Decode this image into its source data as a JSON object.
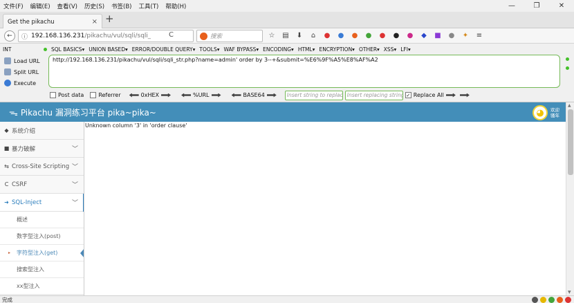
{
  "menubar": {
    "items": [
      "文件(F)",
      "编辑(E)",
      "查看(V)",
      "历史(S)",
      "书签(B)",
      "工具(T)",
      "帮助(H)"
    ]
  },
  "window_controls": [
    "—",
    "❐",
    "✕"
  ],
  "tab": {
    "title": "Get the pikachu",
    "close": "×",
    "new": "+"
  },
  "navbar": {
    "back": "←",
    "info": "ⓘ",
    "url_host": "192.168.136.231",
    "url_path": "/pikachu/vul/sqli/sqli_",
    "reload": "C",
    "search_placeholder": "搜索"
  },
  "hackbar": {
    "select_value": "INT",
    "menu": [
      "SQL BASICS▾",
      "UNION BASED▾",
      "ERROR/DOUBLE QUERY▾",
      "TOOLS▾",
      "WAF BYPASS▾",
      "ENCODING▾",
      "HTML▾",
      "ENCRYPTION▾",
      "OTHER▾",
      "XSS▾",
      "LFI▾"
    ],
    "load_url": "Load URL",
    "split_url": "Split URL",
    "execute": "Execute",
    "url_value": "http://192.168.136.231/pikachu/vul/sqli/sqli_str.php?name=admin' order by 3--+&submit=%E6%9F%A5%E8%AF%A2",
    "post_data": "Post data",
    "referrer": "Referrer",
    "hex": "0xHEX",
    "url_enc": "%URL",
    "base64": "BASE64",
    "replace_placeholder": "Insert string to replace",
    "replacing_placeholder": "Insert replacing string",
    "replace_all": "Replace All",
    "replace_all_checked": "✓"
  },
  "header": {
    "logo": "ᯓ",
    "title": "Pikachu 漏洞练习平台 pika~pika~",
    "welcome": "欢迎 骚年"
  },
  "sidebar": {
    "items": [
      {
        "icon": "◆",
        "label": "系统介绍",
        "chevron": ""
      },
      {
        "icon": "■",
        "label": "暴力破解",
        "chevron": "﹀"
      },
      {
        "icon": "⇆",
        "label": "Cross-Site Scripting",
        "chevron": "﹀"
      },
      {
        "icon": "C",
        "label": "CSRF",
        "chevron": "﹀"
      },
      {
        "icon": "➜",
        "label": "SQL-Inject",
        "chevron": "﹀"
      }
    ],
    "sub": [
      "概述",
      "数字型注入(post)",
      "字符型注入(get)",
      "搜索型注入",
      "xx型注入"
    ],
    "current_mark": "▸"
  },
  "main": {
    "error": "Unknown column '3' in 'order clause'"
  },
  "status": "完成",
  "colors": {
    "header_bg": "#438eb9",
    "accent": "#2b7dbc",
    "hackbar_green": "#75b957"
  }
}
